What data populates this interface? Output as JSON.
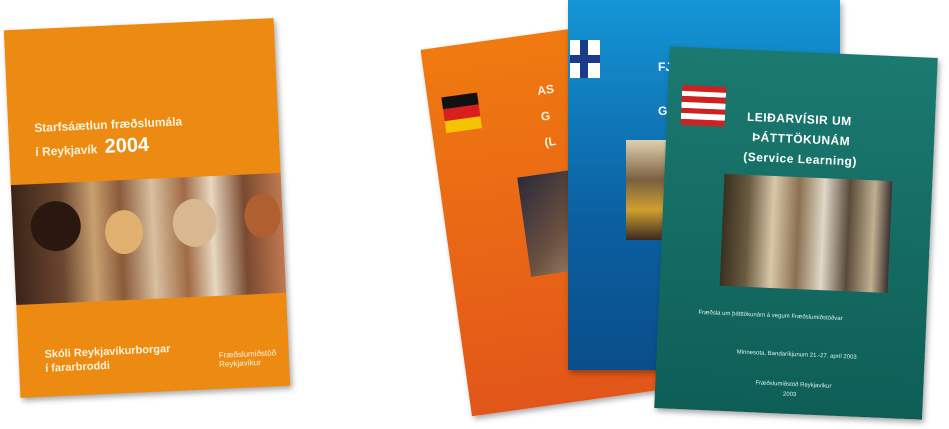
{
  "cover1": {
    "title_line1": "Starfsáætlun fræðslumála",
    "title_line2": "í Reykjavík",
    "year": "2004",
    "bottom_line1": "Skóli Reykjavíkurborgar",
    "bottom_line2": "í fararbroddi",
    "publisher": "Fræðslumiðstöð Reykjavíkur",
    "color": "#ec8a12"
  },
  "cover2": {
    "text1": "AS",
    "text2": "G",
    "text3": "(L",
    "color": "#e2561a"
  },
  "cover3": {
    "text1": "FJÖ",
    "text2": "F",
    "text3": "GR",
    "color": "#1596d6"
  },
  "cover4": {
    "title1": "LEIÐARVÍSIR UM",
    "title2": "ÞÁTTTÖKUNÁM",
    "title3": "(Service Learning)",
    "body": "Fræðsla um þátttökunám á vegum Fræðslumiðstöðvar",
    "dates": "Minnesota, Bandaríkjunum 21.-27. apríl 2003",
    "publisher": "Fræðslumiðstöð Reykjavíkur",
    "year": "2003",
    "color": "#1b7a70"
  }
}
